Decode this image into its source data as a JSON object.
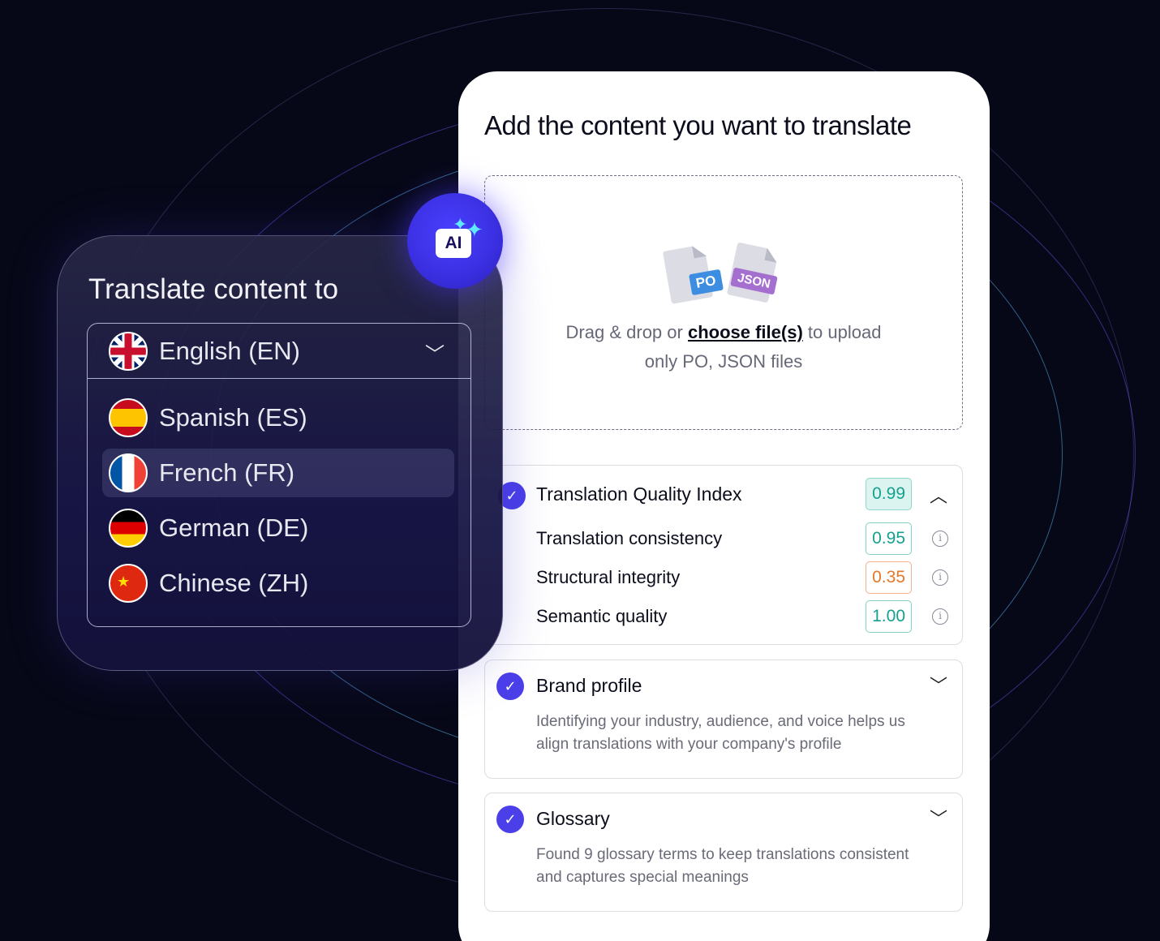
{
  "upload": {
    "title": "Add the content you want to translate",
    "drop_prefix": "Drag & drop or",
    "choose_link": "choose file(s)",
    "drop_suffix": "to upload",
    "drop_hint": "only PO, JSON files",
    "file_types": [
      "PO",
      "JSON"
    ]
  },
  "quality": {
    "title": "Translation Quality Index",
    "score": "0.99",
    "metrics": [
      {
        "label": "Translation consistency",
        "score": "0.95",
        "status": "good"
      },
      {
        "label": "Structural integrity",
        "score": "0.35",
        "status": "bad"
      },
      {
        "label": "Semantic quality",
        "score": "1.00",
        "status": "good"
      }
    ]
  },
  "brand": {
    "title": "Brand profile",
    "description": "Identifying your industry, audience, and voice helps us align translations with your company's profile"
  },
  "glossary": {
    "title": "Glossary",
    "description": "Found 9 glossary terms to keep translations consistent and captures special meanings"
  },
  "language": {
    "title": "Translate content to",
    "selected_source": "English (EN)",
    "options": [
      "Spanish (ES)",
      "French (FR)",
      "German (DE)",
      "Chinese (ZH)"
    ],
    "highlighted": "French (FR)"
  },
  "badge": {
    "label": "AI"
  },
  "colors": {
    "accent": "#4a3fe8",
    "good": "#15a08f",
    "bad": "#e67729"
  }
}
